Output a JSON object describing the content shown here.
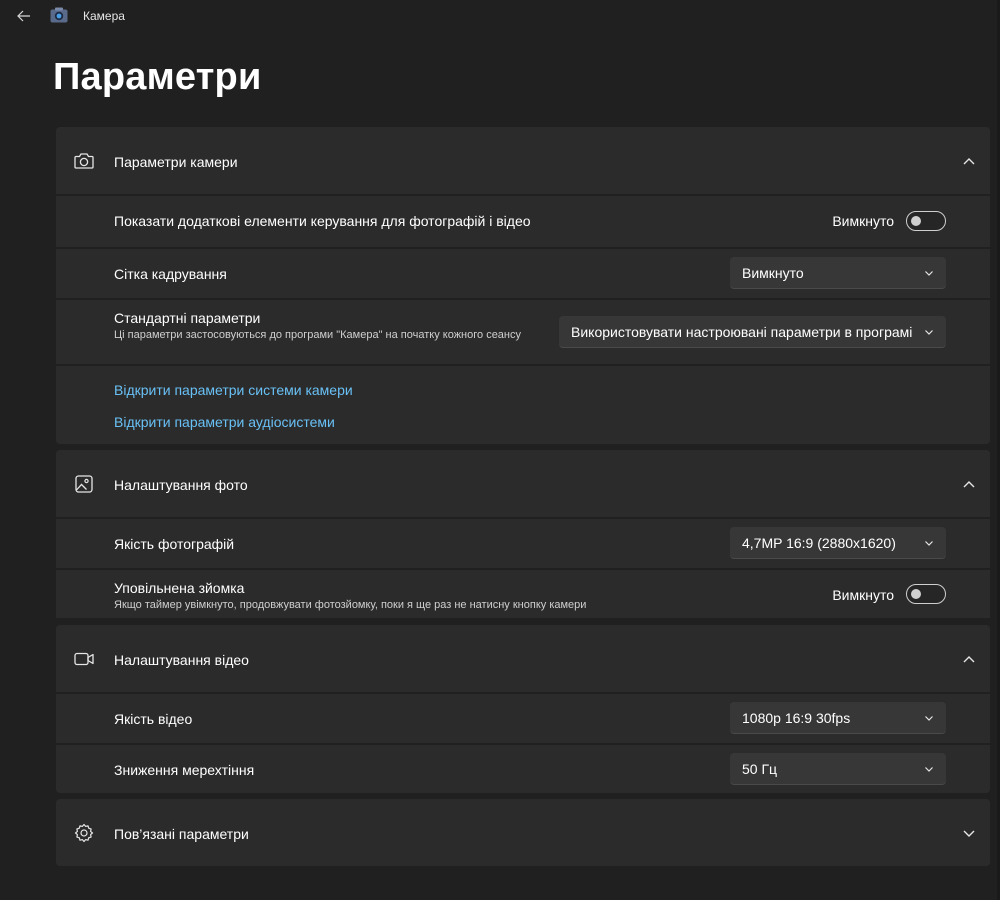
{
  "app": {
    "title": "Камера"
  },
  "page": {
    "title": "Параметри"
  },
  "camera_settings": {
    "title": "Параметри камери",
    "extra_controls": {
      "label": "Показати додаткові елементи керування для фотографій і відео",
      "state": "Вимкнуто"
    },
    "framing_grid": {
      "label": "Сітка кадрування",
      "value": "Вимкнуто"
    },
    "default_settings": {
      "label": "Стандартні параметри",
      "description": "Ці параметри застосовуються до програми \"Камера\" на початку кожного сеансу",
      "value": "Використовувати настроювані параметри в програмі"
    },
    "links": {
      "camera_system": "Відкрити параметри системи камери",
      "audio_system": "Відкрити параметри аудіосистеми"
    }
  },
  "photo_settings": {
    "title": "Налаштування фото",
    "photo_quality": {
      "label": "Якість фотографій",
      "value": "4,7MP 16:9 (2880x1620)"
    },
    "time_lapse": {
      "label": "Уповільнена зйомка",
      "description": "Якщо таймер увімкнуто, продовжувати фотозйомку, поки я ще раз не натисну кнопку камери",
      "state": "Вимкнуто"
    }
  },
  "video_settings": {
    "title": "Налаштування відео",
    "video_quality": {
      "label": "Якість відео",
      "value": "1080p 16:9 30fps"
    },
    "flicker_reduction": {
      "label": "Зниження мерехтіння",
      "value": "50 Гц"
    }
  },
  "related_settings": {
    "title": "Пов’язані параметри"
  },
  "colors": {
    "background": "#202020",
    "card": "#2b2b2b",
    "link": "#69c0f5",
    "control": "#373737"
  }
}
